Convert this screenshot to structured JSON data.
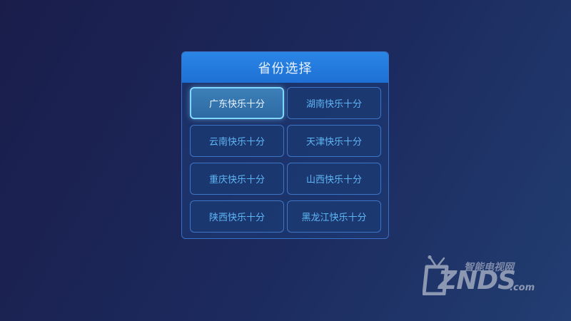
{
  "dialog": {
    "title": "省份选择",
    "provinces": [
      {
        "label": "广东快乐十分",
        "selected": true
      },
      {
        "label": "湖南快乐十分",
        "selected": false
      },
      {
        "label": "云南快乐十分",
        "selected": false
      },
      {
        "label": "天津快乐十分",
        "selected": false
      },
      {
        "label": "重庆快乐十分",
        "selected": false
      },
      {
        "label": "山西快乐十分",
        "selected": false
      },
      {
        "label": "陕西快乐十分",
        "selected": false
      },
      {
        "label": "黑龙江快乐十分",
        "selected": false
      }
    ]
  },
  "watermark": {
    "icon": "tv-icon",
    "subtitle": "智能电视网",
    "brand": "ZNDS",
    "domain": ".com"
  },
  "colors": {
    "header": "#2a86e6",
    "button_text": "#5fb6f5",
    "button_border": "#3b76c9",
    "selected_border": "#7fd6ff"
  }
}
